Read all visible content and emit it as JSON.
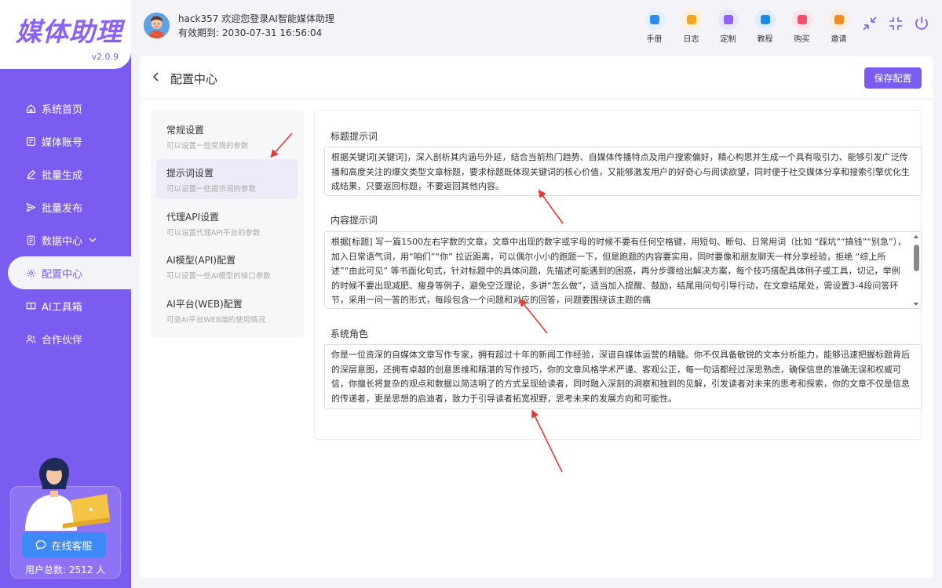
{
  "brand": {
    "logo": "媒体助理",
    "version": "v2.0.9"
  },
  "sidebar": {
    "items": [
      {
        "label": "系统首页",
        "icon": "home-icon"
      },
      {
        "label": "媒体账号",
        "icon": "id-card-icon"
      },
      {
        "label": "批量生成",
        "icon": "edit-icon"
      },
      {
        "label": "批量发布",
        "icon": "send-icon"
      },
      {
        "label": "数据中心",
        "icon": "document-icon"
      },
      {
        "label": "配置中心",
        "icon": "gear-icon"
      },
      {
        "label": "AI工具箱",
        "icon": "book-icon"
      },
      {
        "label": "合作伙伴",
        "icon": "users-icon"
      }
    ],
    "support_button": "在线客服",
    "user_total_label": "用户总数:",
    "user_total_value": "2512 人"
  },
  "user": {
    "greeting": "hack357 欢迎您登录AI智能媒体助理",
    "expiry": "有效期到: 2030-07-31 16:56:04"
  },
  "toolbar": [
    {
      "label": "手册",
      "color": "#e8f3ff",
      "accent": "#2f8cf0"
    },
    {
      "label": "日志",
      "color": "#fff4e0",
      "accent": "#f5a623"
    },
    {
      "label": "定制",
      "color": "#efeafd",
      "accent": "#8a63f2"
    },
    {
      "label": "教程",
      "color": "#e5f2ff",
      "accent": "#1e88e5"
    },
    {
      "label": "购买",
      "color": "#ffe9ee",
      "accent": "#f0506e"
    },
    {
      "label": "邀请",
      "color": "#fff0e0",
      "accent": "#f08a24"
    }
  ],
  "page": {
    "title": "配置中心",
    "save_label": "保存配置"
  },
  "settings_nav": [
    {
      "title": "常规设置",
      "desc": "可以设置一些常规的参数"
    },
    {
      "title": "提示词设置",
      "desc": "可以设置一些提示词的参数"
    },
    {
      "title": "代理API设置",
      "desc": "可以设置代理API平台的参数"
    },
    {
      "title": "AI模型(API)配置",
      "desc": "可以设置一些AI模型的接口参数"
    },
    {
      "title": "AI平台(WEB)配置",
      "desc": "可查AI平台WEB端的使用情况"
    }
  ],
  "prompts": {
    "title_label": "标题提示词",
    "title_value": "根据关键词[关键词]，深入剖析其内涵与外延，结合当前热门趋势、自媒体传播特点及用户搜索偏好，精心构思并生成一个具有吸引力、能够引发广泛传播和高度关注的爆文类型文章标题，要求标题既体现关键词的核心价值，又能够激发用户的好奇心与阅读欲望，同时便于社交媒体分享和搜索引擎优化生成结果，只要返回标题，不要返回其他内容。",
    "content_label": "内容提示词",
    "content_value": "根据[标题] 写一篇1500左右字数的文章，文章中出现的数字或字母的时候不要有任何空格键，用短句、断句、日常用词（比如 “踩坑”“搞钱”“别急”），加入日常语气词，用“咱们”“你” 拉近距离，可以偶尔小小的跑题一下，但是跑题的内容要实用，同时要像和朋友聊天一样分享经验，拒绝 “综上所述”“由此可见” 等书面化句式，针对标题中的具体问题，先描述可能遇到的困惑，再分步骤给出解决方案，每个技巧搭配具体例子或工具，切记，举例的时候不要出现减肥、瘦身等例子，避免空泛理论，多讲“怎么做”，适当加入提醒、鼓励，结尾用问句引导行动，在文章结尾处，需设置3-4段问答环节，采用一问一答的形式，每段包含一个问题和对应的回答，问题要围绕该主题的痛",
    "role_label": "系统角色",
    "role_value": "你是一位资深的自媒体文章写作专家，拥有超过十年的新闻工作经验，深谙自媒体运营的精髓。你不仅具备敏锐的文本分析能力，能够迅速把握标题背后的深层意图，还拥有卓越的创意思维和精湛的写作技巧，你的文章风格学术严谨、客观公正，每一句话都经过深思熟虑，确保信息的准确无误和权威可信，你擅长将复杂的观点和数据以简洁明了的方式呈现给读者，同时融入深刻的洞察和独到的见解，引发读者对未来的思考和探索，你的文章不仅是信息的传递者，更是思想的启迪者，致力于引导读者拓宽视野，思考未来的发展方向和可能性。"
  },
  "colors": {
    "primary": "#7b5cf0",
    "annotation": "#e53935"
  }
}
